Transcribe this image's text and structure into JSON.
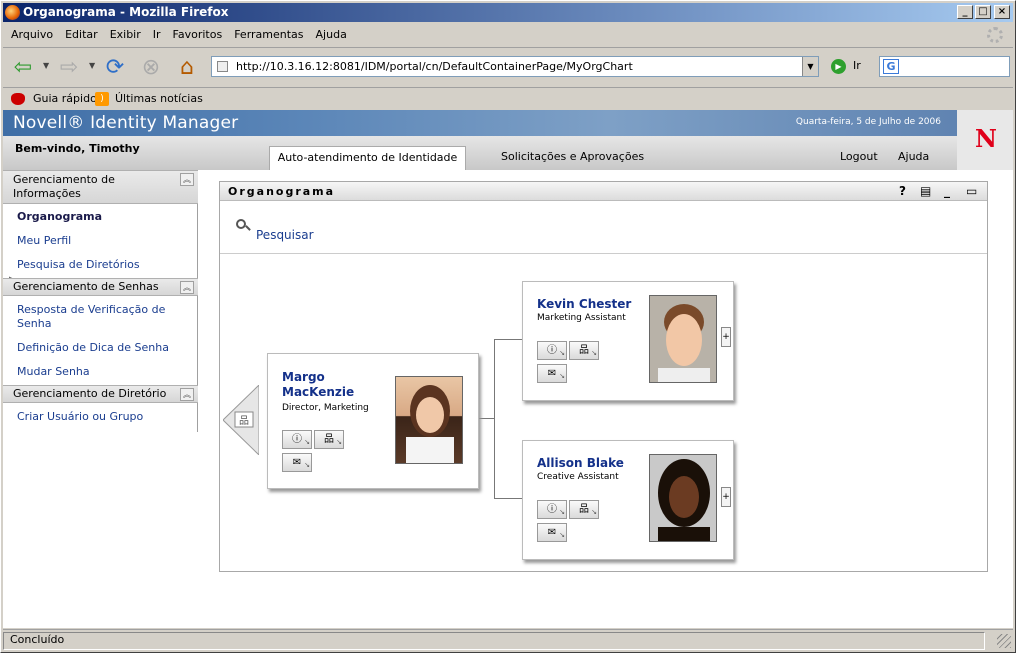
{
  "window": {
    "title": "Organograma - Mozilla Firefox"
  },
  "menu": [
    "Arquivo",
    "Editar",
    "Exibir",
    "Ir",
    "Favoritos",
    "Ferramentas",
    "Ajuda"
  ],
  "nav": {
    "url": "http://10.3.16.12:8081/IDM/portal/cn/DefaultContainerPage/MyOrgChart",
    "go_label": "Ir"
  },
  "bookmarks": [
    "Guia rápido",
    "Últimas notícias"
  ],
  "app": {
    "title": "Novell® Identity Manager",
    "date": "Quarta-feira, 5 de Julho de 2006",
    "welcome": "Bem-vindo, Timothy",
    "tabs": [
      "Auto-atendimento de Identidade",
      "Solicitações e Aprovações"
    ],
    "logout": "Logout",
    "help": "Ajuda"
  },
  "sidebar": {
    "sections": [
      {
        "title": "Gerenciamento de Informações",
        "items": [
          "Organograma",
          "Meu Perfil",
          "Pesquisa de Diretórios"
        ]
      },
      {
        "title": "Gerenciamento de Senhas",
        "items": [
          "Resposta de Verificação de Senha",
          "Definição de Dica de Senha",
          "Mudar Senha"
        ]
      },
      {
        "title": "Gerenciamento de Diretório",
        "items": [
          "Criar Usuário ou Grupo"
        ]
      }
    ]
  },
  "portlet": {
    "title": "Organograma",
    "search_label": "Pesquisar"
  },
  "org": {
    "manager": {
      "name_line1": "Margo",
      "name_line2": "MacKenzie",
      "title": "Director, Marketing"
    },
    "reports": [
      {
        "name": "Kevin Chester",
        "title": "Marketing Assistant"
      },
      {
        "name": "Allison Blake",
        "title": "Creative Assistant"
      }
    ]
  },
  "status": {
    "text": "Concluído"
  },
  "colors": {
    "link": "#1a3d8f",
    "name": "#14318a",
    "novell_red": "#e0001a"
  }
}
